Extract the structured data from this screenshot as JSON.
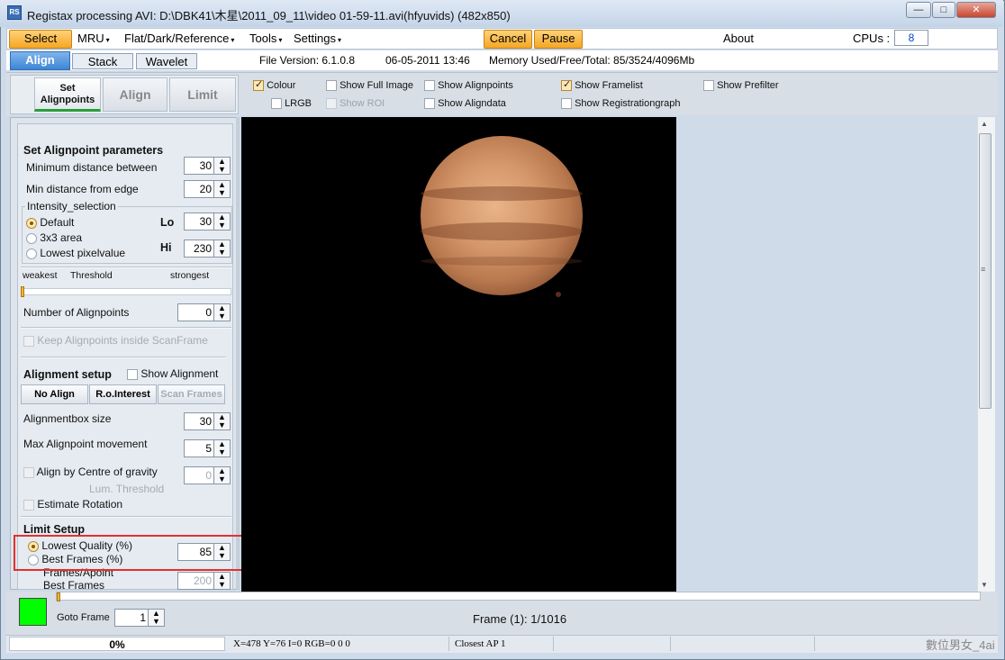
{
  "window": {
    "title": "Registax processing AVI: D:\\DBK41\\木星\\2011_09_11\\video 01-59-11.avi(hfyuvids) (482x850)",
    "icon_text": "RS",
    "min_label": "—",
    "max_label": "□",
    "close_label": "✕"
  },
  "menu": {
    "select": "Select",
    "mru": "MRU",
    "flat": "Flat/Dark/Reference",
    "tools": "Tools",
    "settings": "Settings",
    "cancel": "Cancel",
    "pause": "Pause",
    "about": "About",
    "cpus_label": "CPUs :",
    "cpus_value": "8",
    "arrow": "▾"
  },
  "tabs": {
    "align": "Align",
    "stack": "Stack",
    "wavelet": "Wavelet"
  },
  "info": {
    "file_version": "File Version: 6.1.0.8",
    "date": "06-05-2011 13:46",
    "memory": "Memory Used/Free/Total: 85/3524/4096Mb"
  },
  "modes": {
    "set_alignpoints_1": "Set",
    "set_alignpoints_2": "Alignpoints",
    "align": "Align",
    "limit": "Limit"
  },
  "options": {
    "colour": "Colour",
    "lrgb": "LRGB",
    "show_full_image": "Show Full Image",
    "show_roi": "Show ROI",
    "show_alignpoints": "Show Alignpoints",
    "show_aligndata": "Show Aligndata",
    "show_framelist": "Show Framelist",
    "show_registrationgraph": "Show Registrationgraph",
    "show_prefilter": "Show Prefilter"
  },
  "alignpoints": {
    "heading": "Set Alignpoint parameters",
    "min_distance_label": "Minimum distance between",
    "min_distance_value": "30",
    "min_edge_label": "Min distance from edge",
    "min_edge_value": "20",
    "intensity_group": "Intensity_selection",
    "default": "Default",
    "area3x3": "3x3 area",
    "lowest_pixel": "Lowest pixelvalue",
    "lo_label": "Lo",
    "lo_value": "30",
    "hi_label": "Hi",
    "hi_value": "230",
    "weakest": "weakest",
    "threshold": "Threshold",
    "strongest": "strongest",
    "threshold_value": 0.0,
    "num_label": "Number of Alignpoints",
    "num_value": "0",
    "keep_inside": "Keep Alignpoints inside ScanFrame"
  },
  "alignment": {
    "heading": "Alignment setup",
    "show_alignment": "Show Alignment",
    "no_align": "No Align",
    "ro_interest": "R.o.Interest",
    "scan_frames": "Scan Frames",
    "box_size_label": "Alignmentbox size",
    "box_size_value": "30",
    "max_move_label": "Max Alignpoint movement",
    "max_move_value": "5",
    "centre_gravity": "Align by Centre of gravity",
    "centre_value": "0",
    "lum_threshold": "Lum. Threshold",
    "estimate_rotation": "Estimate Rotation"
  },
  "limit": {
    "heading": "Limit Setup",
    "lowest_quality": "Lowest Quality (%)",
    "best_frames": "Best Frames (%)",
    "quality_value": "85",
    "frames_apoint": "Frames/Apoint",
    "best_frames2": "Best Frames",
    "frames_value": "200"
  },
  "bottom": {
    "swatch_color": "#00ff00",
    "goto_label": "Goto Frame",
    "goto_value": "1",
    "frame_info": "Frame (1): 1/1016",
    "frame_position": 0.0
  },
  "status": {
    "progress": "0%",
    "coords": "X=478 Y=76 I=0 RGB=0 0 0",
    "closest": "Closest AP 1",
    "watermark": "數位男女_4ai"
  },
  "spin_arrows": "▲\n▼"
}
